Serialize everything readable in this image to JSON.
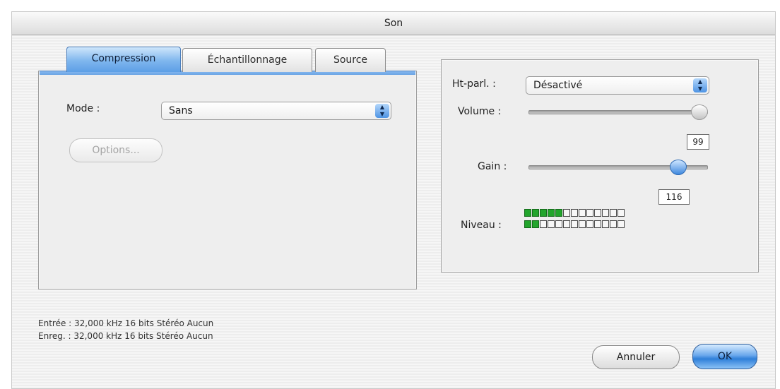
{
  "window": {
    "title": "Son"
  },
  "tabs": [
    {
      "label": "Compression",
      "active": true
    },
    {
      "label": "Échantillonnage",
      "active": false
    },
    {
      "label": "Source",
      "active": false
    }
  ],
  "compression": {
    "mode_label": "Mode :",
    "mode_value": "Sans",
    "options_button": "Options..."
  },
  "speaker": {
    "label": "Ht-parl. :",
    "value": "Désactivé"
  },
  "volume": {
    "label": "Volume :",
    "value": "99",
    "level_fraction": 0.97
  },
  "gain": {
    "label": "Gain :",
    "value": "116",
    "level_fraction": 0.85
  },
  "level": {
    "label": "Niveau :",
    "channels": [
      {
        "active_cells": 5,
        "total_cells": 13
      },
      {
        "active_cells": 2,
        "total_cells": 13
      }
    ]
  },
  "status": {
    "input": "Entrée : 32,000 kHz 16 bits Stéréo Aucun",
    "record": "Enreg. : 32,000 kHz 16 bits Stéréo Aucun"
  },
  "buttons": {
    "cancel": "Annuler",
    "ok": "OK"
  },
  "colors": {
    "accent": "#5d9fe6",
    "meter_on": "#22a52c"
  }
}
